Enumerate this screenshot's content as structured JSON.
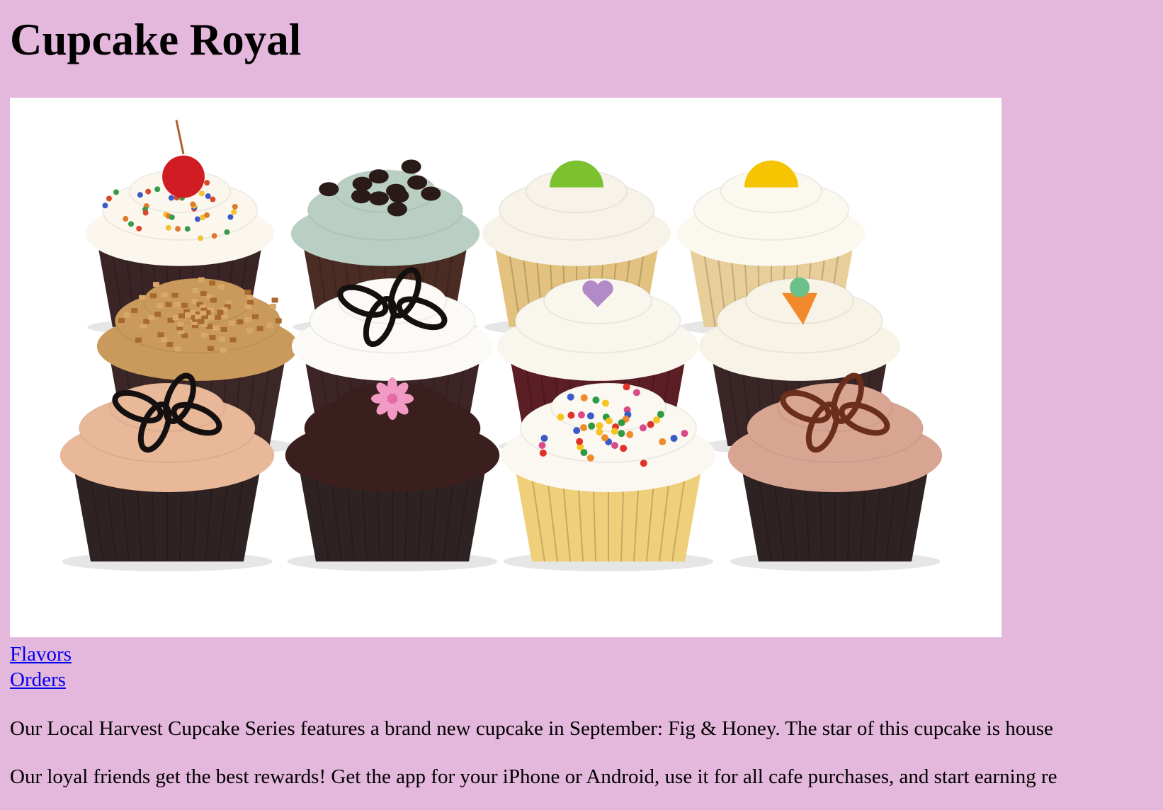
{
  "page": {
    "title": "Cupcake Royal",
    "background": "#e4b7dc",
    "link_color": "#0000ee"
  },
  "hero_image": {
    "alt": "Twelve assorted frosted cupcakes",
    "cupcakes": [
      {
        "frosting": "#fbf7ef",
        "wrapper": "#3a2426",
        "topping": "cherry-sprinkles"
      },
      {
        "frosting": "#b9cfc4",
        "wrapper": "#4a2c24",
        "topping": "cookie-crumbs"
      },
      {
        "frosting": "#f7f3e8",
        "wrapper": "#e2c27e",
        "topping": "lime-slice"
      },
      {
        "frosting": "#fbf8ef",
        "wrapper": "#e8cf9a",
        "topping": "lemon-slice"
      },
      {
        "frosting": "#c99a5b",
        "wrapper": "#3b2726",
        "topping": "chopped-nuts"
      },
      {
        "frosting": "#fbfaf6",
        "wrapper": "#3d2527",
        "topping": "chocolate-drizzle"
      },
      {
        "frosting": "#f9f6ee",
        "wrapper": "#5a1e24",
        "topping": "heart"
      },
      {
        "frosting": "#f8f3e7",
        "wrapper": "#3a2626",
        "topping": "carrot"
      },
      {
        "frosting": "#e8b898",
        "wrapper": "#2f2222",
        "topping": "chocolate-drizzle"
      },
      {
        "frosting": "#3b1f1f",
        "wrapper": "#2f2222",
        "topping": "pink-flower"
      },
      {
        "frosting": "#fbf8f1",
        "wrapper": "#f0cf7a",
        "topping": "rainbow-sprinkles"
      },
      {
        "frosting": "#d9a593",
        "wrapper": "#2f2222",
        "topping": "caramel-drizzle"
      }
    ]
  },
  "nav": {
    "links": [
      {
        "label": "Flavors"
      },
      {
        "label": "Orders"
      }
    ]
  },
  "content": {
    "paragraph_1": "Our Local Harvest Cupcake Series features a brand new cupcake in September: Fig & Honey. The star of this cupcake is house",
    "paragraph_2": "Our loyal friends get the best rewards! Get the app for your iPhone or Android, use it for all cafe purchases, and start earning re"
  }
}
